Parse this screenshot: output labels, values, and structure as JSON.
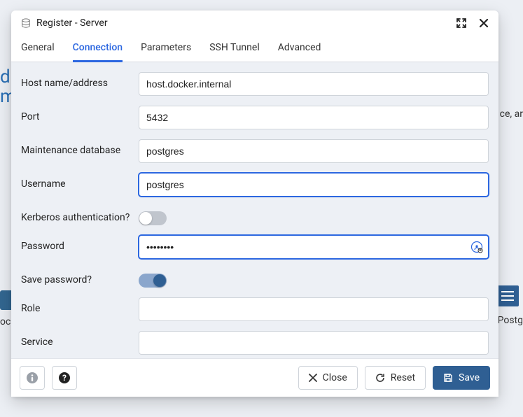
{
  "dialog": {
    "title": "Register - Server"
  },
  "tabs": {
    "general": "General",
    "connection": "Connection",
    "parameters": "Parameters",
    "ssh": "SSH Tunnel",
    "advanced": "Advanced"
  },
  "labels": {
    "host": "Host name/address",
    "port": "Port",
    "maintdb": "Maintenance database",
    "username": "Username",
    "kerberos": "Kerberos authentication?",
    "password": "Password",
    "savepw": "Save password?",
    "role": "Role",
    "service": "Service"
  },
  "values": {
    "host": "host.docker.internal",
    "port": "5432",
    "maintdb": "postgres",
    "username": "postgres",
    "password": "••••••••",
    "role": "",
    "service": ""
  },
  "footer": {
    "close": "Close",
    "reset": "Reset",
    "save": "Save"
  },
  "bg": {
    "d": "d",
    "m": "m",
    "right": "ce, ar",
    "postg": "Postg",
    "oc": "oc"
  }
}
